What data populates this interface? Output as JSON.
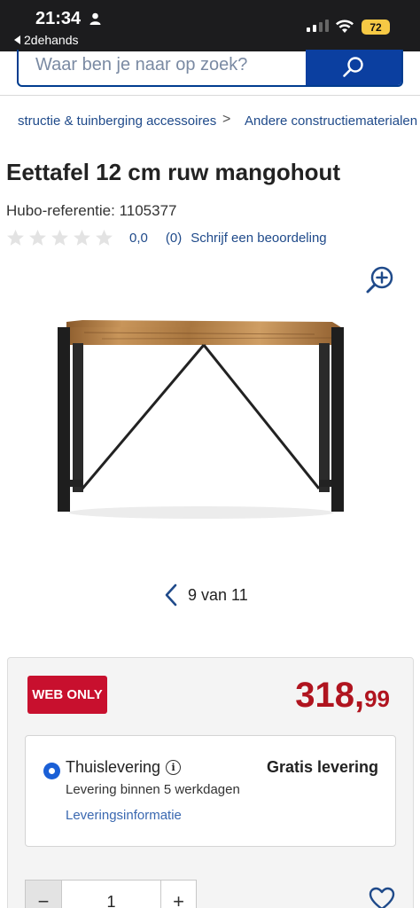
{
  "status_bar": {
    "time": "21:34",
    "back_label": "2dehands",
    "battery": "72"
  },
  "search": {
    "placeholder": "Waar ben je naar op zoek?"
  },
  "breadcrumb": {
    "items": [
      "structie & tuinberging accessoires",
      "Andere constructiematerialen"
    ],
    "separator": ">"
  },
  "product": {
    "title": "Eettafel 12 cm ruw mangohout",
    "reference": "Hubo-referentie: 1105377",
    "rating_score": "0,0",
    "rating_count": "(0)",
    "review_link": "Schrijf een beoordeling",
    "stars_filled": 0,
    "stars_total": 5
  },
  "gallery": {
    "pager": "9 van 11"
  },
  "buy_box": {
    "badge": "WEB ONLY",
    "price_main": "318",
    "price_comma": ",",
    "price_cents": "99",
    "delivery": {
      "title": "Thuislevering",
      "subtitle": "Levering binnen 5 werkdagen",
      "link": "Leveringsinformatie",
      "cost": "Gratis levering"
    },
    "quantity": "1",
    "minus": "−",
    "plus": "+"
  },
  "colors": {
    "brand_blue": "#0b3fa0",
    "price_red": "#b0141f",
    "badge_red": "#c8102e"
  }
}
